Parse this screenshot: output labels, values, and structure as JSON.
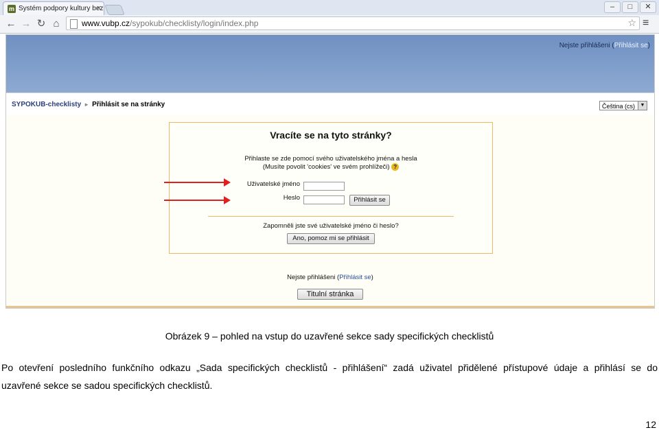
{
  "browser": {
    "tab_title": "Systém podpory kultury bez",
    "url_domain": "www.vubp.cz",
    "url_path": "/sypokub/checklisty/login/index.php",
    "window_buttons": [
      "–",
      "□",
      "✕"
    ]
  },
  "moodle": {
    "header_status_prefix": "Nejste přihlášeni (",
    "header_status_link": "Přihlásit se",
    "header_status_suffix": ")",
    "breadcrumb": [
      "SYPOKUB-checklisty",
      "Přihlásit se na stránky"
    ],
    "language_select": "Čeština (cs)",
    "login": {
      "title": "Vracíte se na tyto stránky?",
      "description_line1": "Přihlaste se zde pomocí svého uživatelského jména a hesla",
      "description_line2": "(Musíte povolit 'cookies' ve svém prohlížeči)",
      "username_label": "Uživatelské jméno",
      "password_label": "Heslo",
      "submit_button": "Přihlásit se",
      "forgot_text": "Zapomněli jste své uživatelské jméno či heslo?",
      "forgot_button": "Ano, pomoz mi se přihlásit"
    },
    "footer_status_prefix": "Nejste přihlášeni (",
    "footer_status_link": "Přihlásit se",
    "footer_status_suffix": ")",
    "home_button": "Titulní stránka"
  },
  "document": {
    "caption": "Obrázek 9 – pohled na vstup do uzavřené sekce sady specifických checklistů",
    "paragraph_line1": "Po otevření posledního funkčního odkazu „Sada specifických checklistů - přihlášení“ zadá uživatel přidělené přístupové údaje a přihlásí se do",
    "paragraph_line2": "uzavřené sekce se sadou specifických checklistů.",
    "page_number": "12"
  }
}
